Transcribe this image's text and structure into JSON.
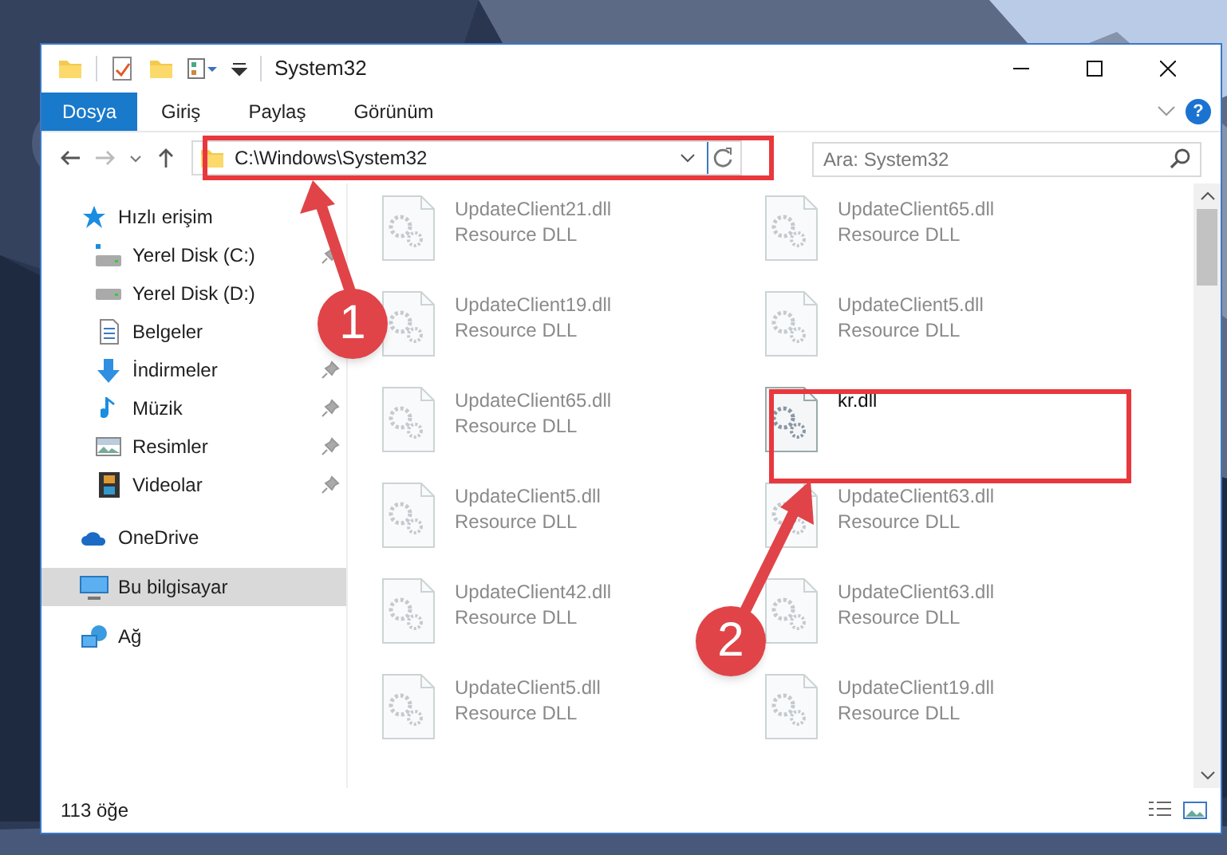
{
  "title_bar": {
    "title": "System32"
  },
  "ribbon": {
    "tabs": [
      {
        "label": "Dosya",
        "selected": true
      },
      {
        "label": "Giriş",
        "selected": false
      },
      {
        "label": "Paylaş",
        "selected": false
      },
      {
        "label": "Görünüm",
        "selected": false
      }
    ],
    "help": "?"
  },
  "address_bar": {
    "path": "C:\\Windows\\System32"
  },
  "search": {
    "placeholder": "Ara: System32"
  },
  "nav": {
    "items": [
      {
        "label": "Hızlı erişim",
        "kind": "star",
        "selected": false,
        "children": [
          {
            "label": "Yerel Disk (C:)",
            "kind": "drive-c",
            "pinned": true,
            "selected": false
          },
          {
            "label": "Yerel Disk (D:)",
            "kind": "drive",
            "pinned": false,
            "selected": false
          },
          {
            "label": "Belgeler",
            "kind": "document",
            "pinned": false,
            "selected": false
          },
          {
            "label": "İndirmeler",
            "kind": "download",
            "pinned": true,
            "selected": false
          },
          {
            "label": "Müzik",
            "kind": "music",
            "pinned": true,
            "selected": false
          },
          {
            "label": "Resimler",
            "kind": "pictures",
            "pinned": true,
            "selected": false
          },
          {
            "label": "Videolar",
            "kind": "video",
            "pinned": true,
            "selected": false
          }
        ]
      },
      {
        "label": "OneDrive",
        "kind": "cloud",
        "selected": false
      },
      {
        "label": "Bu bilgisayar",
        "kind": "computer",
        "selected": true
      },
      {
        "label": "Ağ",
        "kind": "network",
        "selected": false
      }
    ]
  },
  "files": [
    {
      "name": "UpdateClient21.dll",
      "type": "Resource DLL",
      "blurred": true
    },
    {
      "name": "UpdateClient65.dll",
      "type": "Resource DLL",
      "blurred": true
    },
    {
      "name": "UpdateClient19.dll",
      "type": "Resource DLL",
      "blurred": true
    },
    {
      "name": "UpdateClient5.dll",
      "type": "Resource DLL",
      "blurred": true
    },
    {
      "name": "UpdateClient65.dll",
      "type": "Resource DLL",
      "blurred": true
    },
    {
      "name": "kr.dll",
      "blurred": false
    },
    {
      "name": "UpdateClient5.dll",
      "type": "Resource DLL",
      "blurred": true
    },
    {
      "name": "UpdateClient63.dll",
      "type": "Resource DLL",
      "blurred": true
    },
    {
      "name": "UpdateClient42.dll",
      "type": "Resource DLL",
      "blurred": true
    },
    {
      "name": "UpdateClient63.dll",
      "type": "Resource DLL",
      "blurred": true
    },
    {
      "name": "UpdateClient5.dll",
      "type": "Resource DLL",
      "blurred": true
    },
    {
      "name": "UpdateClient19.dll",
      "type": "Resource DLL",
      "blurred": true
    }
  ],
  "status_bar": {
    "count": "113 öğe"
  },
  "annotations": [
    {
      "number": "1"
    },
    {
      "number": "2"
    }
  ]
}
